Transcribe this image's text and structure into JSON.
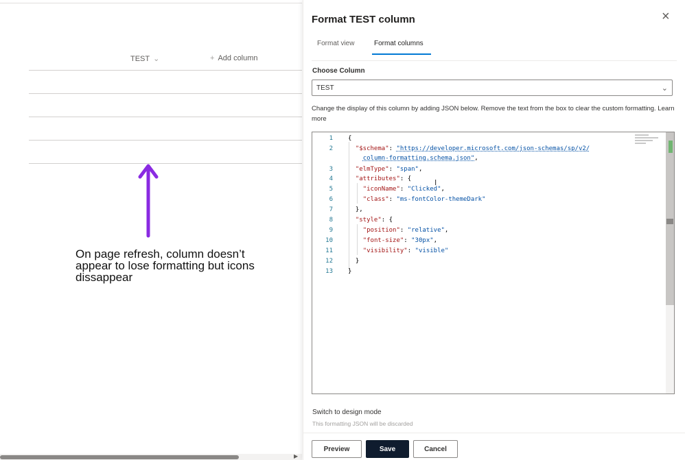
{
  "list": {
    "columns": [
      {
        "label": "TEST",
        "icon": "chevron-down-icon"
      },
      {
        "label": "Add column",
        "icon": "plus-icon"
      }
    ],
    "annotation": "On page refresh, column doesn’t appear to lose formatting but icons dissappear",
    "arrow_color": "#8a2be2"
  },
  "panel": {
    "title": "Format TEST column",
    "close_icon": "close-icon",
    "tabs": [
      {
        "label": "Format view",
        "selected": false
      },
      {
        "label": "Format columns",
        "selected": true
      }
    ],
    "choose_label": "Choose Column",
    "choose_value": "TEST",
    "description": "Change the display of this column by adding JSON below. Remove the text from the box to clear the custom formatting.",
    "learn_more": "Learn more",
    "editor": {
      "line_numbers": [
        "1",
        "2",
        "3",
        "4",
        "5",
        "6",
        "7",
        "8",
        "9",
        "10",
        "11",
        "12",
        "13"
      ],
      "lines": {
        "l1": "{",
        "l2_key": "\"$schema\"",
        "l2_val": "\"https://developer.microsoft.com/json-schemas/sp/v2/",
        "l2_cont": "column-formatting.schema.json\"",
        "l3_key": "\"elmType\"",
        "l3_val": "\"span\"",
        "l4_key": "\"attributes\"",
        "l4_brace": "{",
        "l5_key": "\"iconName\"",
        "l5_val": "\"Clicked\"",
        "l6_key": "\"class\"",
        "l6_val": "\"ms-fontColor-themeDark\"",
        "l7": "},",
        "l8_key": "\"style\"",
        "l8_brace": "{",
        "l9_key": "\"position\"",
        "l9_val": "\"relative\"",
        "l10_key": "\"font-size\"",
        "l10_val": "\"30px\"",
        "l11_key": "\"visibility\"",
        "l11_val": "\"visible\"",
        "l12": "}",
        "l13": "}"
      }
    },
    "switch_mode": "Switch to design mode",
    "switch_note": "This formatting JSON will be discarded",
    "buttons": {
      "preview": "Preview",
      "save": "Save",
      "cancel": "Cancel"
    },
    "accent_color": "#0078d4",
    "save_color": "#0f1c2e"
  }
}
